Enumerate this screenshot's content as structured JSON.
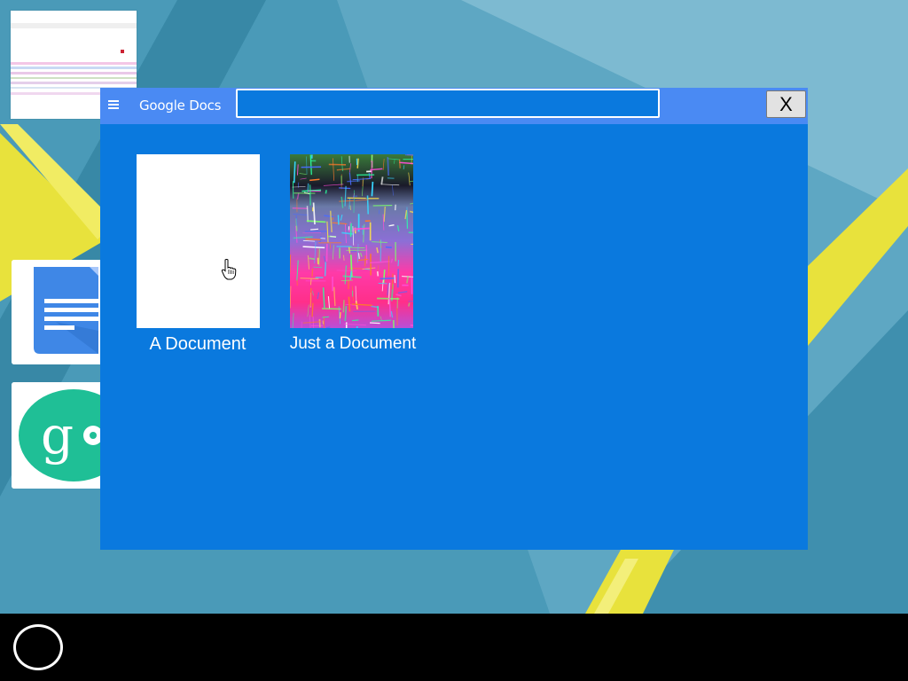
{
  "app": {
    "title": "Google Docs",
    "close_label": "X",
    "search": {
      "value": "",
      "placeholder": ""
    }
  },
  "documents": [
    {
      "label": "A Document",
      "thumbnail": "blank-page"
    },
    {
      "label": "Just a Document",
      "thumbnail": "colorful-noise-image"
    }
  ],
  "desktop": {
    "shortcuts": [
      {
        "icon": "google-docs-icon"
      },
      {
        "icon": "google-settings-icon"
      }
    ],
    "thumbnail": "window-preview"
  },
  "taskbar": {
    "launcher_icon": "circle-launcher-icon"
  },
  "colors": {
    "window_body": "#0a79de",
    "titlebar": "#4a8af3",
    "desktop": "#3f8fae",
    "taskbar": "#000000",
    "accent_yellow": "#e8e23c"
  }
}
